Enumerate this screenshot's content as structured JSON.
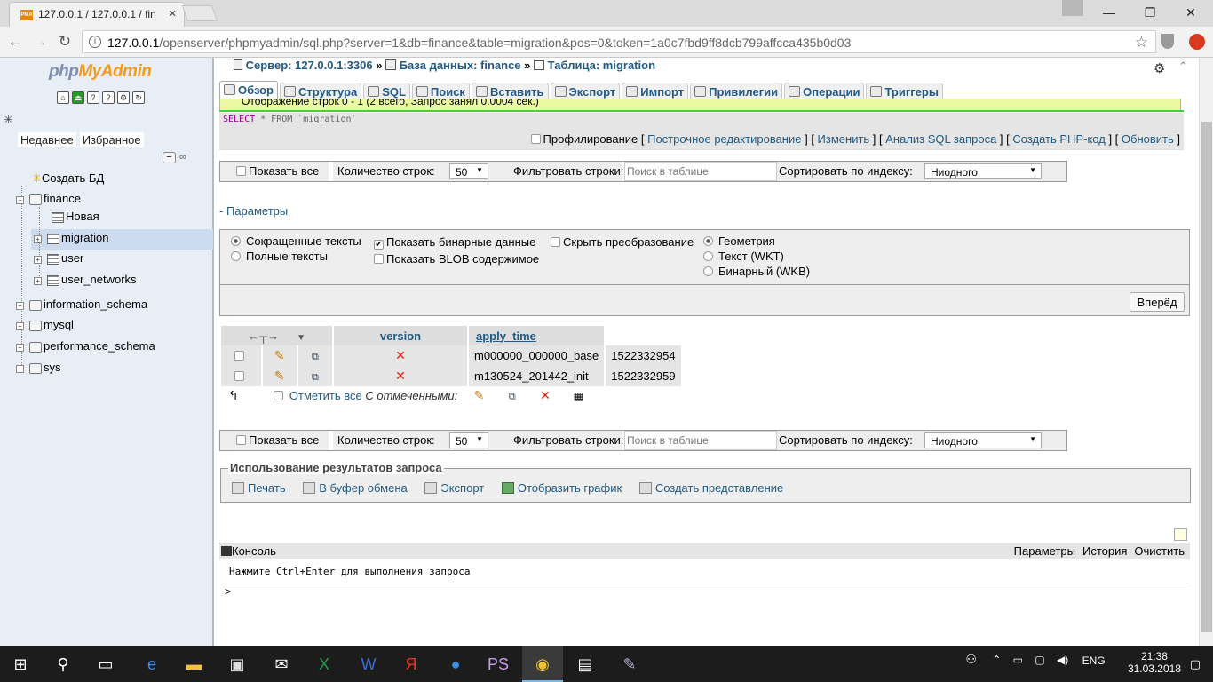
{
  "browser": {
    "tab_title": "127.0.0.1 / 127.0.0.1 / fin",
    "tab_close": "✕",
    "url_host": "127.0.0.1",
    "url_path": "/openserver/phpmyadmin/sql.php?server=1&db=finance&table=migration&pos=0&token=1a0c7fbd9ff8dcb799affcca435b0d03",
    "window_controls": {
      "minimize": "—",
      "maximize": "❐",
      "close": "✕"
    }
  },
  "sidebar": {
    "logo_php": "php",
    "logo_myadmin": "MyAdmin",
    "tabs": [
      "Недавнее",
      "Избранное"
    ],
    "create_db": "Создать БД",
    "tree": [
      {
        "label": "finance",
        "children": [
          "Новая",
          "migration",
          "user",
          "user_networks"
        ]
      },
      {
        "label": "information_schema"
      },
      {
        "label": "mysql"
      },
      {
        "label": "performance_schema"
      },
      {
        "label": "sys"
      }
    ],
    "selected": "migration"
  },
  "breadcrumb": {
    "server_label": "Сервер: 127.0.0.1:3306",
    "db_label": "База данных: finance",
    "table_label": "Таблица: migration",
    "sep": "»"
  },
  "tabs": [
    "Обзор",
    "Структура",
    "SQL",
    "Поиск",
    "Вставить",
    "Экспорт",
    "Импорт",
    "Привилегии",
    "Операции",
    "Триггеры"
  ],
  "active_tab": "Обзор",
  "message": "Отображение строк 0 - 1 (2 всего, Запрос занял 0.0004 сек.)",
  "sql": {
    "keyword": "SELECT",
    "rest": " * FROM `migration`"
  },
  "sql_links": {
    "profiling": "Профилирование",
    "items": [
      "Построчное редактирование",
      "Изменить",
      "Анализ SQL запроса",
      "Создать PHP-код",
      "Обновить"
    ]
  },
  "navbar": {
    "show_all": "Показать все",
    "row_count_label": "Количество строк:",
    "row_count": "50",
    "filter_label": "Фильтровать строки:",
    "filter_placeholder": "Поиск в таблице",
    "sort_label": "Сортировать по индексу:",
    "sort_value": "Ниодного"
  },
  "params_link": "- Параметры",
  "options": {
    "text_short": "Сокращенные тексты",
    "text_full": "Полные тексты",
    "show_binary": "Показать бинарные данные",
    "show_blob": "Показать BLOB содержимое",
    "hide_transform": "Скрыть преобразование",
    "geometry": "Геометрия",
    "wkt": "Текст (WKT)",
    "wkb": "Бинарный (WKB)",
    "forward_button": "Вперёд"
  },
  "table": {
    "headers": [
      "version",
      "apply_time"
    ],
    "rows": [
      [
        "m000000_000000_base",
        "1522332954"
      ],
      [
        "m130524_201442_init",
        "1522332959"
      ]
    ]
  },
  "with_selected": {
    "check_all": "Отметить все",
    "label": "С отмеченными:"
  },
  "usage": {
    "legend": "Использование результатов запроса",
    "actions": [
      "Печать",
      "В буфер обмена",
      "Экспорт",
      "Отобразить график",
      "Создать представление"
    ]
  },
  "console": {
    "title": "Консоль",
    "links": [
      "Параметры",
      "История",
      "Очистить"
    ],
    "hint": "Нажмите Ctrl+Enter для выполнения запроса",
    "prompt": ">"
  },
  "taskbar": {
    "lang": "ENG",
    "time": "21:38",
    "date": "31.03.2018"
  }
}
